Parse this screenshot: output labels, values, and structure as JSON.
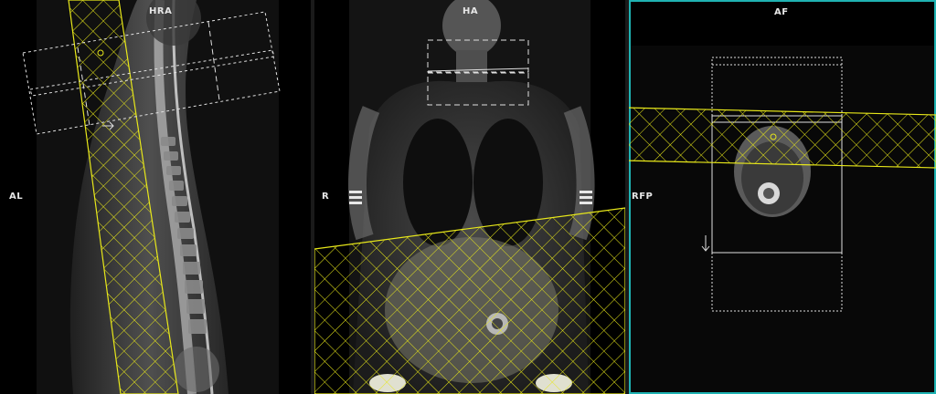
{
  "viewports": [
    {
      "name": "sagittal",
      "orientation_top": "HRA",
      "orientation_left": "AL"
    },
    {
      "name": "coronal",
      "orientation_top": "HA",
      "orientation_left": "R"
    },
    {
      "name": "axial",
      "orientation_top": "AF",
      "orientation_left": "RFP",
      "active": true
    }
  ],
  "colors": {
    "planning_box": "#e8e81a",
    "active_border": "#1fb3b3",
    "fov_outline": "#e0e0e0"
  },
  "icons": {
    "menu": "hamburger-icon",
    "direction": "arrow-down-icon"
  }
}
